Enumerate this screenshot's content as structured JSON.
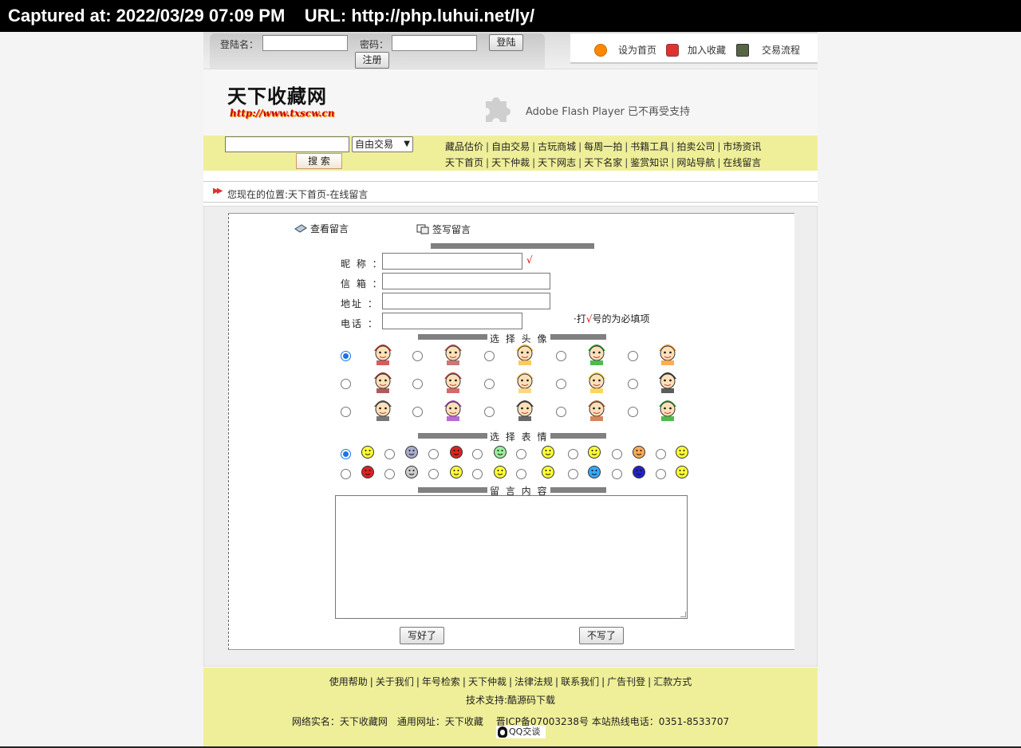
{
  "capture": {
    "text": "Captured at: 2022/03/29 07:09 PM    URL: http://php.luhui.net/ly/"
  },
  "login": {
    "username_label": "登陆名：",
    "password_label": "密码：",
    "login_button": "登陆",
    "register_button": "注册"
  },
  "toplinks": {
    "homepage": "设为首页",
    "favorite": "加入收藏",
    "process": "交易流程"
  },
  "header": {
    "logo_title": "天下收藏网",
    "logo_url": "http://www.txscw.cn",
    "flash_text": "Adobe Flash Player 已不再受支持"
  },
  "search": {
    "select_value": "自由交易",
    "button": "搜 索"
  },
  "nav": {
    "row1": [
      "藏品估价",
      "自由交易",
      "古玩商城",
      "每周一拍",
      "书籍工具",
      "拍卖公司",
      "市场资讯"
    ],
    "row2": [
      "天下首页",
      "天下仲裁",
      "天下网志",
      "天下名家",
      "鉴赏知识",
      "网站导航",
      "在线留言"
    ]
  },
  "location": {
    "text": "您现在的位置:天下首页-在线留言"
  },
  "tabs": {
    "view": "查看留言",
    "write": "签写留言"
  },
  "form": {
    "nickname_label": "昵 称 ：",
    "email_label": "信 箱 ：",
    "address_label": "地址 ：",
    "phone_label": "电话 ：",
    "check_mark": "√",
    "note_prefix": "·打",
    "note_mark": "√",
    "note_suffix": "号的为必填项",
    "avatar_section": "选 择 头 像",
    "emotion_section": "选 择 表 情",
    "content_section": "留 言 内 容",
    "submit_button": "写好了",
    "cancel_button": "不写了"
  },
  "avatar_colors": [
    "#c33",
    "#b55",
    "#fb3",
    "#2a2",
    "#f92",
    "#933",
    "#c44",
    "#fc6",
    "#fc3",
    "#333",
    "#555",
    "#a4c",
    "#444",
    "#c63",
    "#2a2"
  ],
  "emotion_colors": [
    "#ff3",
    "#aac",
    "#d22",
    "#9e9",
    "#ff3",
    "#ff3",
    "#fa5",
    "#ff3",
    "#d22",
    "#ccc",
    "#ff3",
    "#ff3",
    "#ff3",
    "#3af",
    "#22c",
    "#ff3"
  ],
  "footer": {
    "links": [
      "使用帮助",
      "关于我们",
      "年号检索",
      "天下仲裁",
      "法律法规",
      "联系我们",
      "广告刊登",
      "汇款方式"
    ],
    "support": "技术支持:酷源码下载",
    "info": "网络实名：天下收藏网　通用网址：天下收藏　 晋ICP备07003238号 本站热线电话：0351-8533707",
    "qq": "QQ交谈"
  }
}
